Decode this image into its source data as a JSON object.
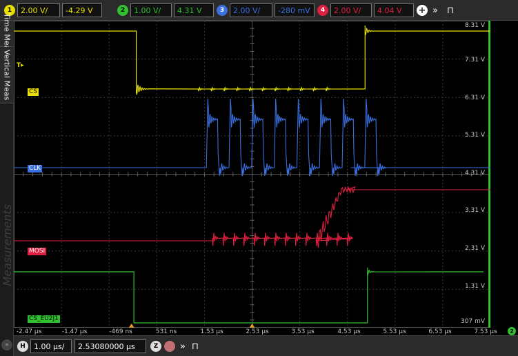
{
  "channels": [
    {
      "num": "1",
      "scale": "2.00 V/",
      "offset": "-4.29 V",
      "color": "#e8e000"
    },
    {
      "num": "2",
      "scale": "1.00 V/",
      "offset": "4.31 V",
      "color": "#30c030"
    },
    {
      "num": "3",
      "scale": "2.00 V/",
      "offset": "-280 mV",
      "color": "#3a6fe0"
    },
    {
      "num": "4",
      "scale": "2.00 V/",
      "offset": "4.04 V",
      "color": "#e02040"
    }
  ],
  "side_tabs": {
    "time_meas": "Time Meas",
    "vertical_meas": "Vertical Meas",
    "measurements": "Measurements"
  },
  "trigger_marker": "T",
  "trace_labels": {
    "cs": "CS",
    "clk": "CLK",
    "mosi": "MOSI",
    "cs_eu2j1": "CS_EU2J1"
  },
  "right_axis": [
    "8.31 V",
    "7.31 V",
    "6.31 V",
    "5.31 V",
    "4.31 V",
    "3.31 V",
    "2.31 V",
    "1.31 V",
    "307 mV"
  ],
  "right_axis_channel": "2",
  "time_axis": [
    "-2.47 µs",
    "-1.47 µs",
    "-469 ns",
    "531 ns",
    "1.53 µs",
    "2.53 µs",
    "3.53 µs",
    "4.53 µs",
    "5.53 µs",
    "6.53 µs",
    "7.53 µs"
  ],
  "timebase": {
    "badge": "H",
    "scale": "1.00 µs/",
    "delay": "2.53080000 µs",
    "zoom_badge": "Z"
  },
  "chart_data": {
    "type": "line",
    "x_range_us": [
      -2.47,
      7.53
    ],
    "series": [
      {
        "name": "CS",
        "levels": "high, then low from ~0.1 µs to ~4.9 µs, then high"
      },
      {
        "name": "CLK",
        "bursts": 8
      },
      {
        "name": "MOSI",
        "levels": "low until ~4.0 µs, then high"
      },
      {
        "name": "CS_EU2J1",
        "levels": "high, low from ~0.1 µs to ~4.9 µs, high"
      }
    ]
  }
}
